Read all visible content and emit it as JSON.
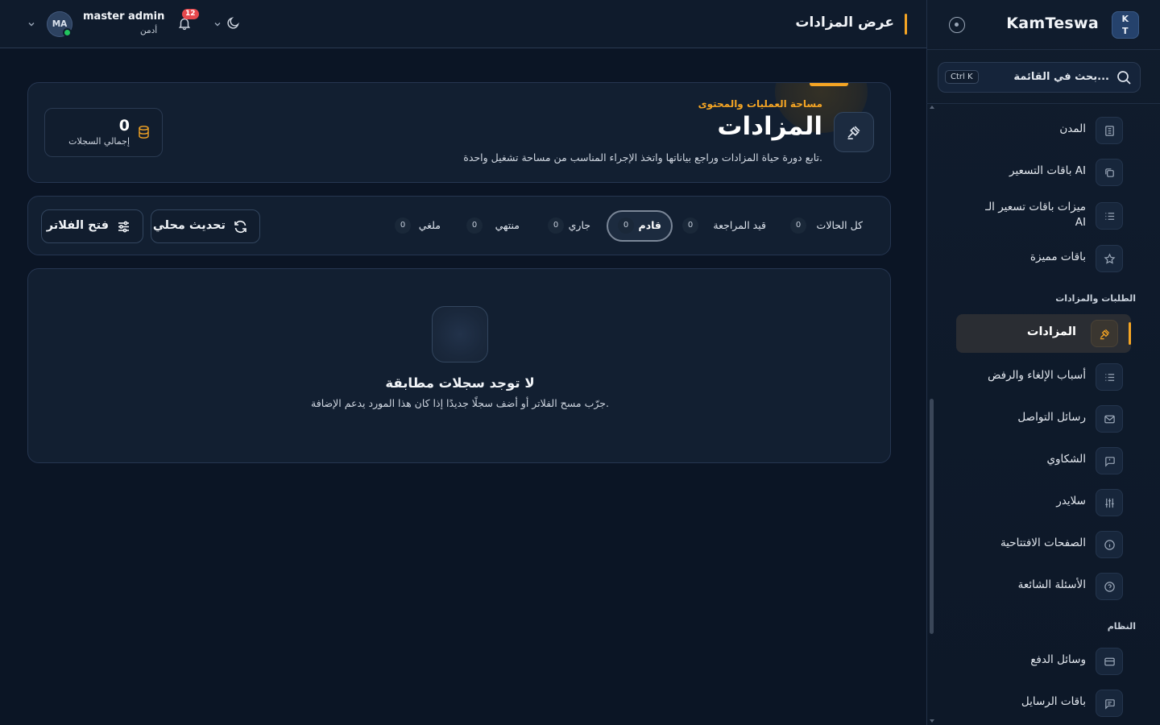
{
  "brand": {
    "logo_text": "K\nT",
    "name": "KamTeswa"
  },
  "search": {
    "placeholder": "بحث في القائمة...",
    "shortcut": "Ctrl K"
  },
  "sidebar": {
    "items": [
      {
        "label": "المدن",
        "icon": "building-icon"
      },
      {
        "label": "باقات التسعير AI",
        "icon": "copy-icon"
      },
      {
        "label": "ميزات باقات تسعير الـ AI",
        "icon": "list-icon"
      },
      {
        "label": "باقات مميزة",
        "icon": "star-icon"
      },
      {
        "label": "المزادات",
        "icon": "gavel-icon",
        "active": true
      },
      {
        "label": "أسباب الإلغاء والرفض",
        "icon": "list-icon"
      },
      {
        "label": "رسائل التواصل",
        "icon": "mail-icon"
      },
      {
        "label": "الشكاوي",
        "icon": "message-icon"
      },
      {
        "label": "سلايدر",
        "icon": "sliders-icon"
      },
      {
        "label": "الصفحات الافتتاحية",
        "icon": "info-icon"
      },
      {
        "label": "الأسئلة الشائعة",
        "icon": "help-icon"
      },
      {
        "label": "وسائل الدفع",
        "icon": "card-icon"
      },
      {
        "label": "باقات الرسايل",
        "icon": "chat-icon"
      }
    ],
    "sections": {
      "requests": "الطلبات والمزادات",
      "system": "النظام"
    }
  },
  "header": {
    "title": "عرض المزادات",
    "user": {
      "initials": "MA",
      "name": "master admin",
      "role": "أدمن"
    },
    "notifications_count": "12"
  },
  "hero": {
    "kicker": "مساحة العمليات والمحتوى",
    "title": "المزادات",
    "description": "تابع دورة حياة المزادات وراجع بياناتها واتخذ الإجراء المناسب من مساحة تشغيل واحدة.",
    "stat": {
      "value": "0",
      "label": "إجمالي السجلات"
    }
  },
  "filters": {
    "tabs": [
      {
        "label": "كل الحالات",
        "count": "0"
      },
      {
        "label": "قيد المراجعة",
        "count": "0"
      },
      {
        "label": "قادم",
        "count": "0",
        "active": true
      },
      {
        "label": "جاري",
        "count": "0"
      },
      {
        "label": "منتهي",
        "count": "0"
      },
      {
        "label": "ملغي",
        "count": "0"
      }
    ],
    "refresh_label": "تحديث محلي",
    "open_filters_label": "فتح الفلاتر"
  },
  "empty_state": {
    "title": "لا توجد سجلات مطابقة",
    "description": "جرّب مسح الفلاتر أو أضف سجلًا جديدًا إذا كان هذا المورد يدعم الإضافة."
  },
  "colors": {
    "accent": "#f5a524",
    "background": "#0b1525",
    "card": "#121f31",
    "online": "#22c55e",
    "badge": "#e5484d"
  }
}
